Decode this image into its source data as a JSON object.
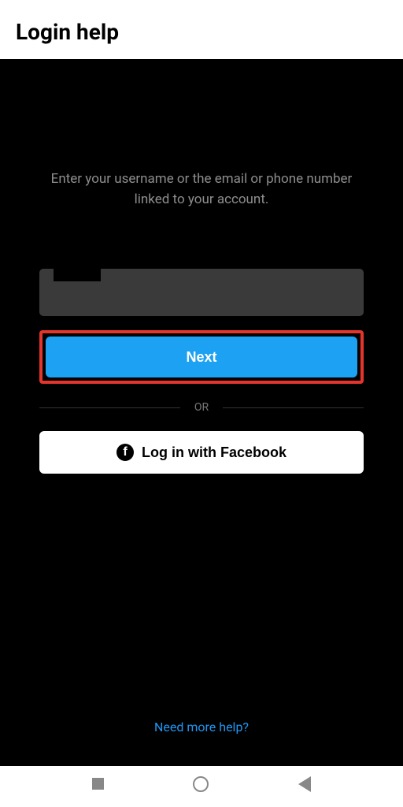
{
  "header": {
    "title": "Login help"
  },
  "instruction": "Enter your username or the email or phone number linked to your account.",
  "input": {
    "value": "",
    "placeholder": ""
  },
  "buttons": {
    "next": "Next",
    "facebook": "Log in with Facebook"
  },
  "divider": "OR",
  "help_link": "Need more help?",
  "colors": {
    "accent": "#1da1f2",
    "highlight": "#e4352d",
    "link": "#2196f3"
  }
}
